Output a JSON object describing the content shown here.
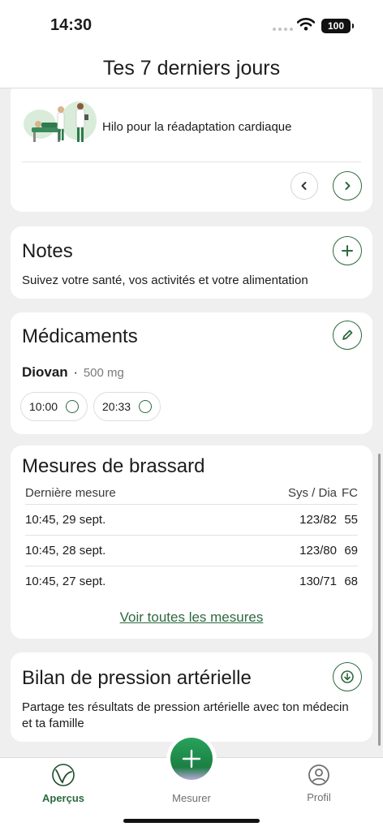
{
  "status_bar": {
    "time": "14:30",
    "battery": "100"
  },
  "header": {
    "title": "Tes 7 derniers jours"
  },
  "promo_card": {
    "text": "Hilo pour la réadaptation cardiaque"
  },
  "notes_card": {
    "title": "Notes",
    "description": "Suivez votre santé, vos activités et votre alimentation"
  },
  "medications_card": {
    "title": "Médicaments",
    "medication": {
      "name": "Diovan",
      "separator": "·",
      "dose": "500 mg"
    },
    "times": [
      "10:00",
      "20:33"
    ]
  },
  "cuff_card": {
    "title": "Mesures de brassard",
    "headers": {
      "last": "Dernière mesure",
      "sysdia": "Sys / Dia",
      "hr": "FC"
    },
    "rows": [
      {
        "date": "10:45, 29 sept.",
        "sysdia": "123/82",
        "hr": "55"
      },
      {
        "date": "10:45, 28 sept.",
        "sysdia": "123/80",
        "hr": "69"
      },
      {
        "date": "10:45, 27 sept.",
        "sysdia": "130/71",
        "hr": "68"
      }
    ],
    "link": "Voir toutes les mesures"
  },
  "report_card": {
    "title": "Bilan de pression artérielle",
    "description": "Partage tes résultats de pression artérielle avec ton médecin et ta famille"
  },
  "tab_bar": {
    "tabs": [
      "Aperçus",
      "Mesurer",
      "Profil"
    ],
    "active": "Aperçus"
  },
  "colors": {
    "accent": "#2c6a3e",
    "background": "#efefef",
    "fab": "#27a35a"
  }
}
